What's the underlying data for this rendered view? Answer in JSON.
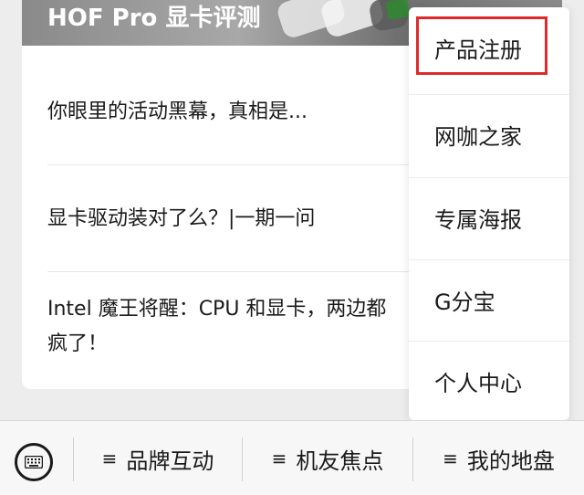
{
  "article_list": {
    "banner_title": "HOF Pro 显卡评测",
    "items": [
      {
        "title": "你眼里的活动黑幕，真相是..."
      },
      {
        "title": "显卡驱动装对了么？|一期一问"
      },
      {
        "title_line1": "Intel 魔王将醒：CPU 和显卡，两边都",
        "title_line2": "疯了！"
      }
    ]
  },
  "popup_menu": {
    "items": [
      {
        "label": "产品注册",
        "highlighted": true
      },
      {
        "label": "网咖之家"
      },
      {
        "label": "专属海报"
      },
      {
        "label": "G分宝"
      },
      {
        "label": "个人中心"
      }
    ],
    "highlight_color": "#e02a2a"
  },
  "bottom_bar": {
    "keyboard_icon": "keyboard-icon",
    "menu_glyph": "≡",
    "menus": [
      {
        "label": "品牌互动"
      },
      {
        "label": "机友焦点"
      },
      {
        "label": "我的地盘"
      }
    ]
  }
}
